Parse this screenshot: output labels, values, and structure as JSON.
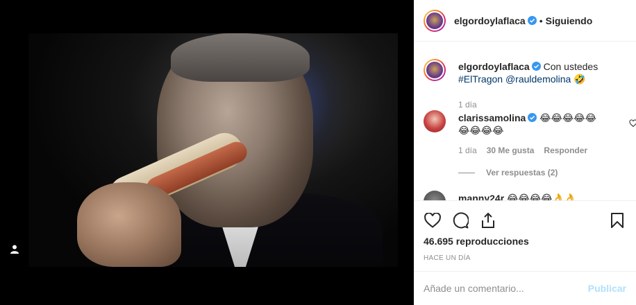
{
  "post": {
    "video_area": {
      "user_tag_icon": "person-icon"
    },
    "header": {
      "username": "elgordoylaflaca",
      "separator": "•",
      "follow_status": "Siguiendo"
    },
    "caption": {
      "username": "elgordoylaflaca",
      "text": "Con ustedes",
      "hashtag": "#ElTragon",
      "mention": "@rauldemolina",
      "emoji": "🤣",
      "time": "1 día"
    },
    "comments": [
      {
        "username": "clarissamolina",
        "text_line1": "😂😂😂😂😂",
        "text_line2": "😂😂😂😂",
        "time": "1 día",
        "likes": "30 Me gusta",
        "reply_label": "Responder",
        "view_replies": "Ver respuestas (2)"
      },
      {
        "username": "manny24r",
        "text": "😂😂😂😂👌👌"
      }
    ],
    "actions": {
      "like_icon": "heart-icon",
      "comment_icon": "comment-icon",
      "share_icon": "share-icon",
      "save_icon": "bookmark-icon"
    },
    "views": "46.695 reproducciones",
    "posted": "Hace un día",
    "add_comment": {
      "placeholder": "Añade un comentario...",
      "publish_label": "Publicar"
    },
    "colors": {
      "verified": "#3897f0",
      "link": "#003569",
      "muted": "#8e8e8e",
      "publish_disabled": "#b2dffc"
    }
  }
}
